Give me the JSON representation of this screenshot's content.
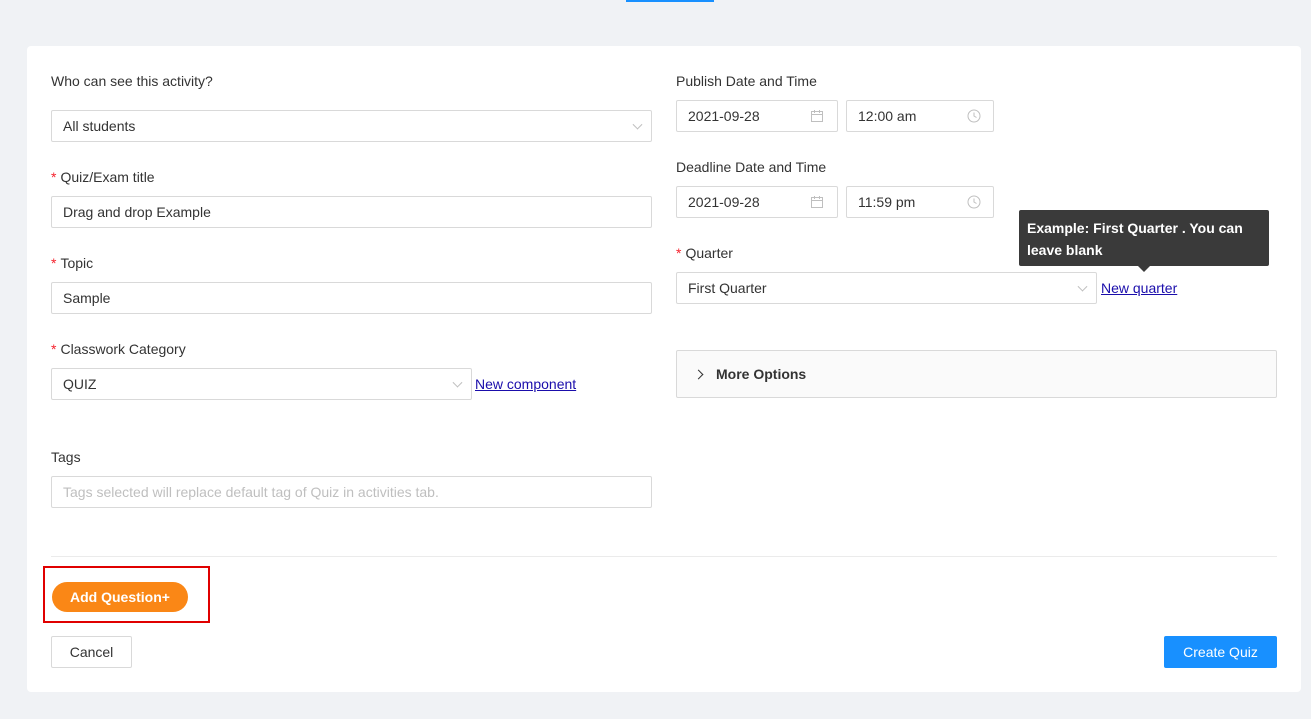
{
  "form": {
    "visibility": {
      "label": "Who can see this activity?",
      "value": "All students"
    },
    "title": {
      "label": "Quiz/Exam title",
      "required_mark": "*",
      "value": "Drag and drop Example"
    },
    "topic": {
      "label": "Topic",
      "required_mark": "*",
      "value": "Sample"
    },
    "category": {
      "label": "Classwork Category",
      "required_mark": "*",
      "value": "QUIZ",
      "new_link": "New component"
    },
    "tags": {
      "label": "Tags",
      "placeholder": "Tags selected will replace default tag of Quiz in activities tab."
    },
    "publish": {
      "label": "Publish Date and Time",
      "date": "2021-09-28",
      "time": "12:00 am"
    },
    "deadline": {
      "label": "Deadline Date and Time",
      "date": "2021-09-28",
      "time": "11:59 pm"
    },
    "quarter": {
      "label": "Quarter",
      "required_mark": "*",
      "value": "First Quarter",
      "new_link": "New quarter",
      "tooltip": "Example: First Quarter . You can leave blank"
    },
    "more_options": {
      "label": "More Options"
    }
  },
  "actions": {
    "add_question": "Add Question+",
    "cancel": "Cancel",
    "create": "Create Quiz"
  },
  "colors": {
    "primary": "#1890ff",
    "accent_orange": "#fa8716",
    "highlight_red": "#e00000",
    "required_red": "#f5222d"
  }
}
